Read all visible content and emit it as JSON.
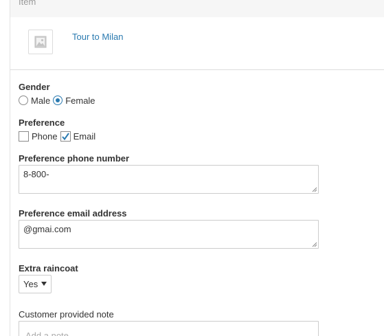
{
  "table_header": {
    "column_label": "Item"
  },
  "item": {
    "name": "Tour to Milan",
    "thumbnail_icon": "image-placeholder-icon"
  },
  "gender": {
    "label": "Gender",
    "options": [
      {
        "label": "Male",
        "selected": false
      },
      {
        "label": "Female",
        "selected": true
      }
    ]
  },
  "preference": {
    "label": "Preference",
    "options": [
      {
        "label": "Phone",
        "checked": false
      },
      {
        "label": "Email",
        "checked": true
      }
    ]
  },
  "phone": {
    "label": "Preference phone number",
    "value": "8-800-"
  },
  "email": {
    "label": "Preference email address",
    "value": "@gmai.com"
  },
  "raincoat": {
    "label": "Extra raincoat",
    "selected": "Yes"
  },
  "note": {
    "label": "Customer provided note",
    "placeholder": "Add a note"
  },
  "colors": {
    "link": "#2a7ab0",
    "accent": "#2a7ab0",
    "header_bg": "#f6f6f6",
    "border": "#cccccc"
  }
}
